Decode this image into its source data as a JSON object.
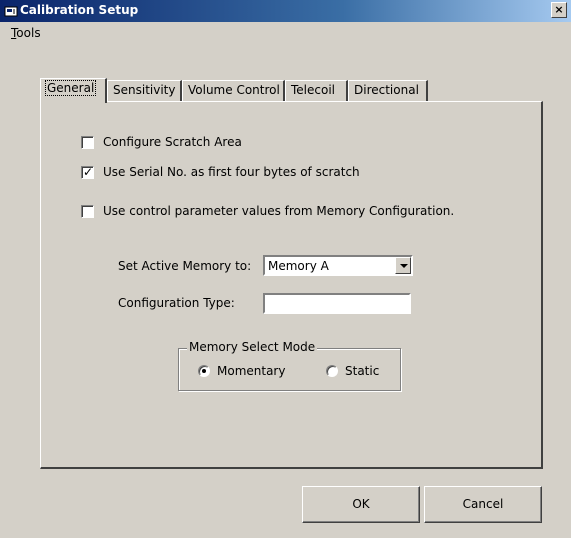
{
  "window": {
    "title": "Calibration Setup",
    "close_glyph": "×"
  },
  "menu": {
    "tools_accel": "T",
    "tools_rest": "ools"
  },
  "tabs": [
    {
      "label": "General",
      "active": true
    },
    {
      "label": "Sensitivity",
      "active": false
    },
    {
      "label": "Volume Control",
      "active": false
    },
    {
      "label": "Telecoil",
      "active": false
    },
    {
      "label": "Directional",
      "active": false
    }
  ],
  "general": {
    "checkboxes": [
      {
        "label": "Configure Scratch Area",
        "checked": false
      },
      {
        "label": "Use Serial No. as first four bytes of scratch",
        "checked": true
      },
      {
        "label": "Use control parameter values from Memory Configuration.",
        "checked": false
      }
    ],
    "check_glyph": "✓",
    "active_memory": {
      "label": "Set Active Memory to:",
      "value": "Memory A"
    },
    "config_type": {
      "label": "Configuration Type:",
      "value": ""
    },
    "memory_select_mode": {
      "title": "Memory Select Mode",
      "options": [
        {
          "label": "Momentary",
          "selected": true
        },
        {
          "label": "Static",
          "selected": false
        }
      ]
    }
  },
  "buttons": {
    "ok": "OK",
    "cancel": "Cancel"
  }
}
